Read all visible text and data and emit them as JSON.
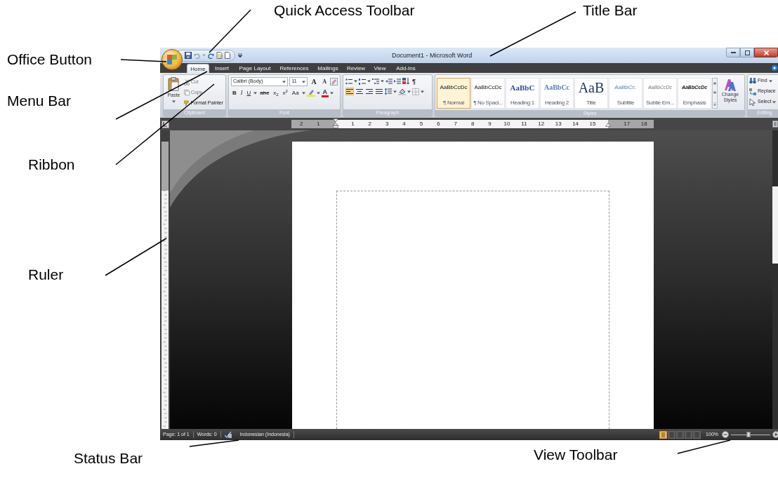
{
  "annotations": [
    {
      "label": "Office Button"
    },
    {
      "label": "Quick Access Toolbar"
    },
    {
      "label": "Title Bar"
    },
    {
      "label": "Menu Bar"
    },
    {
      "label": "Ribbon"
    },
    {
      "label": "Ruler"
    },
    {
      "label": "Status Bar"
    },
    {
      "label": "View Toolbar"
    }
  ],
  "window": {
    "title": "Document1 - Microsoft Word"
  },
  "tabs": [
    {
      "label": "Home",
      "selected": true
    },
    {
      "label": "Insert",
      "selected": false
    },
    {
      "label": "Page Layout",
      "selected": false
    },
    {
      "label": "References",
      "selected": false
    },
    {
      "label": "Mailings",
      "selected": false
    },
    {
      "label": "Review",
      "selected": false
    },
    {
      "label": "View",
      "selected": false
    },
    {
      "label": "Add-Ins",
      "selected": false
    }
  ],
  "ribbon": {
    "clipboard": {
      "label": "Clipboard",
      "paste": "Paste",
      "items": [
        {
          "label": "Cut",
          "disabled": true
        },
        {
          "label": "Copy",
          "disabled": true
        },
        {
          "label": "Format Painter",
          "disabled": false
        }
      ]
    },
    "font": {
      "label": "Font",
      "font_name": "Calibri (Body)",
      "font_size": "11",
      "grow_font": "A",
      "shrink_font": "A",
      "format_buttons": [
        "B",
        "I",
        "U",
        "abc",
        "x$_{2}$",
        "x$^{2}$",
        "Aa"
      ],
      "font_color": "A"
    },
    "paragraph": {
      "label": "Paragraph",
      "show_marks": "¶",
      "alignment_buttons": [
        {
          "selected": true
        },
        {
          "selected": false
        },
        {
          "selected": false
        },
        {
          "selected": false
        }
      ]
    },
    "styles": {
      "label": "Styles",
      "items": [
        {
          "preview": "AaBbCcDc",
          "name": "¶ Normal",
          "selected": true
        },
        {
          "preview": "AaBbCcDc",
          "name": "¶ No Spaci...",
          "selected": false
        },
        {
          "preview": "AaBbC",
          "name": "Heading 1",
          "selected": false
        },
        {
          "preview": "AaBbCc",
          "name": "Heading 2",
          "selected": false
        },
        {
          "preview": "AaB",
          "name": "Title",
          "selected": false
        },
        {
          "preview": "AaBbCc.",
          "name": "Subtitle",
          "selected": false
        },
        {
          "preview": "AaBbCcDc",
          "name": "Subtle Em...",
          "selected": false
        },
        {
          "preview": "AaBbCcDc",
          "name": "Emphasis",
          "selected": false
        }
      ],
      "change_styles": "Change Styles"
    },
    "editing": {
      "label": "Editing",
      "items": [
        "Find",
        "Replace",
        "Select"
      ]
    }
  },
  "ruler": {
    "numbers": [
      "2",
      "1",
      "1",
      "2",
      "3",
      "4",
      "5",
      "6",
      "7",
      "8",
      "9",
      "10",
      "11",
      "12",
      "13",
      "14",
      "15",
      "17",
      "18"
    ]
  },
  "status_bar": {
    "page": "Page: 1 of 1",
    "words": "Words: 0",
    "language": "Indonesian (Indonesia)",
    "view_buttons": [
      {
        "selected": true
      },
      {
        "selected": false
      },
      {
        "selected": false
      },
      {
        "selected": false
      },
      {
        "selected": false
      }
    ],
    "zoom": "100%",
    "zoom_slider": {
      "level": 0.45
    }
  }
}
